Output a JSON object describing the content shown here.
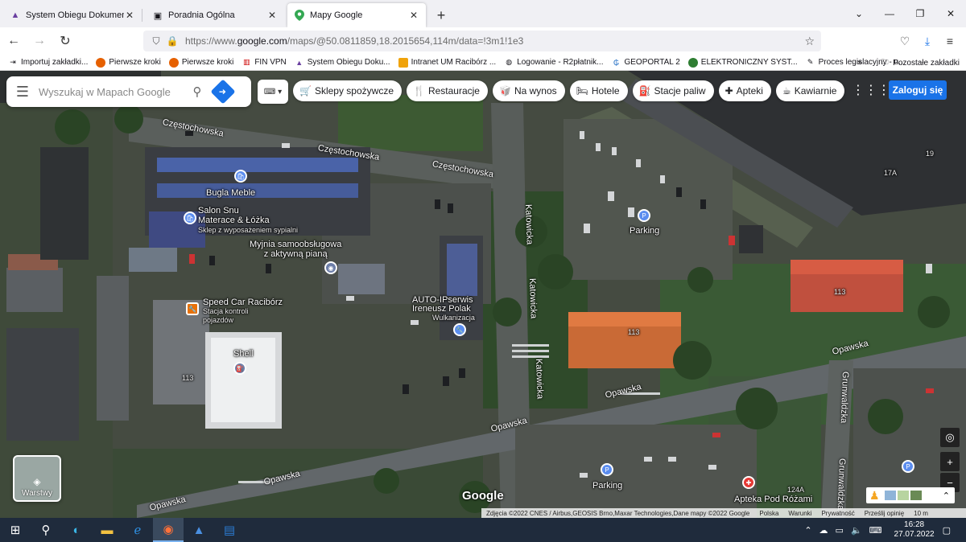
{
  "tabs": [
    {
      "title": "System Obiegu Dokumentów - ",
      "icon": "sod-icon",
      "color": "#6a3fa0"
    },
    {
      "title": "Poradnia Ogólna",
      "icon": "poradnia-icon",
      "color": "#555"
    },
    {
      "title": "Mapy Google",
      "icon": "google-maps-icon",
      "color": "#34a853",
      "active": true
    }
  ],
  "nav": {
    "url_prefix": "https://www.",
    "url_domain": "google.com",
    "url_rest": "/maps/@50.0811859,18.2015654,114m/data=!3m1!1e3"
  },
  "bookmarks": [
    "Importuj zakładki...",
    "Pierwsze kroki",
    "Pierwsze kroki",
    "FIN VPN",
    "System Obiegu Doku...",
    "Intranet UM Racibórz ...",
    "Logowanie - R2płatnik...",
    "GEOPORTAL 2",
    "ELEKTRONICZNY SYST...",
    "Proces legislacyjny - u..."
  ],
  "bookmarks_other": "Pozostałe zakładki",
  "search": {
    "placeholder": "Wyszukaj w Mapach Google"
  },
  "chips": [
    {
      "label": "Sklepy spożywcze",
      "icon": "🛒"
    },
    {
      "label": "Restauracje",
      "icon": "🍴"
    },
    {
      "label": "Na wynos",
      "icon": "🥡"
    },
    {
      "label": "Hotele",
      "icon": "🛏"
    },
    {
      "label": "Stacje paliw",
      "icon": "⛽"
    },
    {
      "label": "Apteki",
      "icon": "✚"
    },
    {
      "label": "Kawiarnie",
      "icon": "☕"
    }
  ],
  "signin": "Zaloguj się",
  "map": {
    "roads": {
      "r1": "Częstochowska",
      "r2": "Częstochowska",
      "r3": "Częstochowska",
      "r4": "Katowicka",
      "r5": "Katowicka",
      "r6": "Katowicka",
      "r7": "Opawska",
      "r8": "Opawska",
      "r9": "Opawska",
      "r10": "Opawska",
      "r11": "Opawska",
      "r12": "Grunwaldzka",
      "r13": "Grunwaldzka"
    },
    "places": {
      "bugla": "Bugla Meble",
      "salon": "Salon Snu",
      "salon2": "Materace & Łóżka",
      "salon_sub": "Sklep z wyposażeniem sypialni",
      "myjnia": "Myjnia samoobsługowa",
      "myjnia2": "z aktywną pianą",
      "speedcar": "Speed Car Racibórz",
      "speedcar_sub": "Stacja kontroli",
      "speedcar_sub2": "pojazdów",
      "shell": "Shell",
      "auto": "AUTO-IPserwis",
      "auto2": "Ireneusz Polak",
      "auto_sub": "Wulkanizacja",
      "parking1": "Parking",
      "parking2": "Parking",
      "apteka": "Apteka Pod Różami"
    },
    "numbers": {
      "n113": "113",
      "n113b": "113",
      "n113c": "113",
      "n124a": "124A",
      "n17a": "17A",
      "n19": "19"
    },
    "layers_label": "Warstwy",
    "logo": "Google",
    "footer": [
      "Zdjęcia ©2022 CNES / Airbus,GEOSIS Brno,Maxar Technologies,Dane mapy ©2022 Google",
      "Polska",
      "Warunki",
      "Prywatność",
      "Prześlij opinię",
      "10 m"
    ]
  },
  "taskbar": {
    "time": "16:28",
    "date": "27.07.2022"
  }
}
